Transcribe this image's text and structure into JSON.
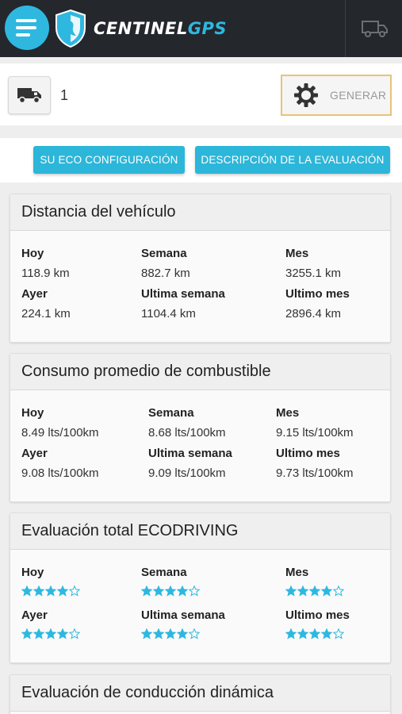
{
  "brand": {
    "logo_text_main": "CENTINEL",
    "logo_text_accent": "GPS",
    "accent_color": "#2eb8e0"
  },
  "vehicle": {
    "number": "1",
    "generate_label": "GENERAR"
  },
  "actions": {
    "eco_config_label": "SU ECO CONFIGURACIÓN",
    "evaluation_desc_label": "DESCRIPCIÓN DE LA EVALUACIÓN"
  },
  "distance": {
    "title": "Distancia del vehículo",
    "today_label": "Hoy",
    "today": "118.9 km",
    "week_label": "Semana",
    "week": "882.7 km",
    "month_label": "Mes",
    "month": "3255.1 km",
    "yesterday_label": "Ayer",
    "yesterday": "224.1 km",
    "last_week_label": "Ultima semana",
    "last_week": "1104.4 km",
    "last_month_label": "Ultimo mes",
    "last_month": "2896.4 km"
  },
  "fuel": {
    "title": "Consumo promedio de combustible",
    "today_label": "Hoy",
    "today": "8.49 lts/100km",
    "week_label": "Semana",
    "week": "8.68 lts/100km",
    "month_label": "Mes",
    "month": "9.15 lts/100km",
    "yesterday_label": "Ayer",
    "yesterday": "9.08 lts/100km",
    "last_week_label": "Ultima semana",
    "last_week": "9.09 lts/100km",
    "last_month_label": "Ultimo mes",
    "last_month": "9.73 lts/100km"
  },
  "ecodriving": {
    "title": "Evaluación total ECODRIVING",
    "star_color": "#2eb8e0",
    "today_label": "Hoy",
    "today_rating": 4,
    "week_label": "Semana",
    "week_rating": 4,
    "month_label": "Mes",
    "month_rating": 4,
    "yesterday_label": "Ayer",
    "yesterday_rating": 4,
    "last_week_label": "Ultima semana",
    "last_week_rating": 4,
    "last_month_label": "Ultimo mes",
    "last_month_rating": 4,
    "max_rating": 5
  },
  "dynamic": {
    "title": "Evaluación de conducción dinámica"
  }
}
